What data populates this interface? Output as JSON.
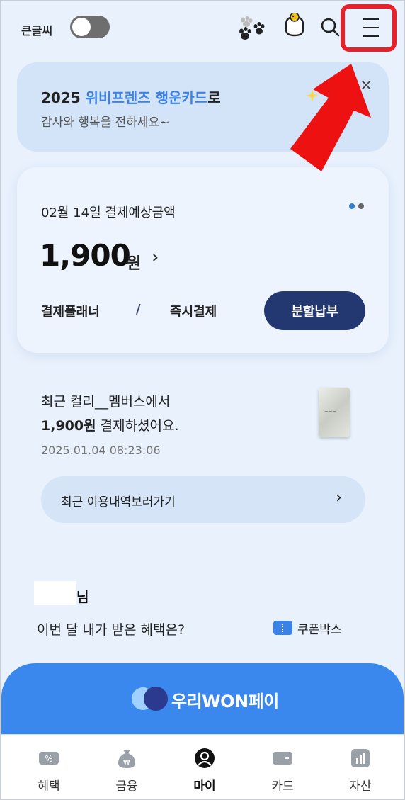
{
  "header": {
    "big_font_label": "큰글씨",
    "big_font_toggle_on": false,
    "icons": [
      "paw-icon",
      "character-icon",
      "search-icon",
      "menu-icon"
    ]
  },
  "banner": {
    "year": "2025 ",
    "highlight": "위비프렌즈 행운카드",
    "suffix": "로",
    "line2": "감사와 행복을 전하세요~",
    "close": "×"
  },
  "payment": {
    "date_title": "02월 14일 결제예상금액",
    "amount": "1,900",
    "unit": "원",
    "chevron": "›",
    "planner": "결제플래너",
    "slash": "/",
    "instant": "즉시결제",
    "installment_button": "분할납부",
    "page_dots": [
      "#2f7fd8",
      "#666666"
    ]
  },
  "recent": {
    "line1": "최근 컬리__멤버스에서",
    "amount": "1,900원",
    "line2_rest": " 결제하셨어요.",
    "timestamp": "2025.01.04 08:23:06",
    "history_button": "최근 이용내역보러가기",
    "history_chevron": "›"
  },
  "benefits": {
    "name_suffix": "님",
    "question": "이번 달 내가 받은 혜택은?",
    "coupon_label": "쿠폰박스"
  },
  "wonpay": {
    "title_prefix": "우리",
    "title_won": "WON",
    "title_suffix": "페이"
  },
  "bottom_nav": {
    "items": [
      {
        "label": "혜택",
        "icon": "benefit-icon"
      },
      {
        "label": "금융",
        "icon": "money-bag-icon"
      },
      {
        "label": "마이",
        "icon": "user-icon",
        "active": true
      },
      {
        "label": "카드",
        "icon": "card-icon"
      },
      {
        "label": "자산",
        "icon": "chart-icon"
      }
    ]
  },
  "colors": {
    "background": "#e8f1fc",
    "accent_blue": "#3c82e6",
    "navy_button": "#233870",
    "highlight_red": "#e8202a",
    "wonpay_blue": "#3a87ee"
  }
}
